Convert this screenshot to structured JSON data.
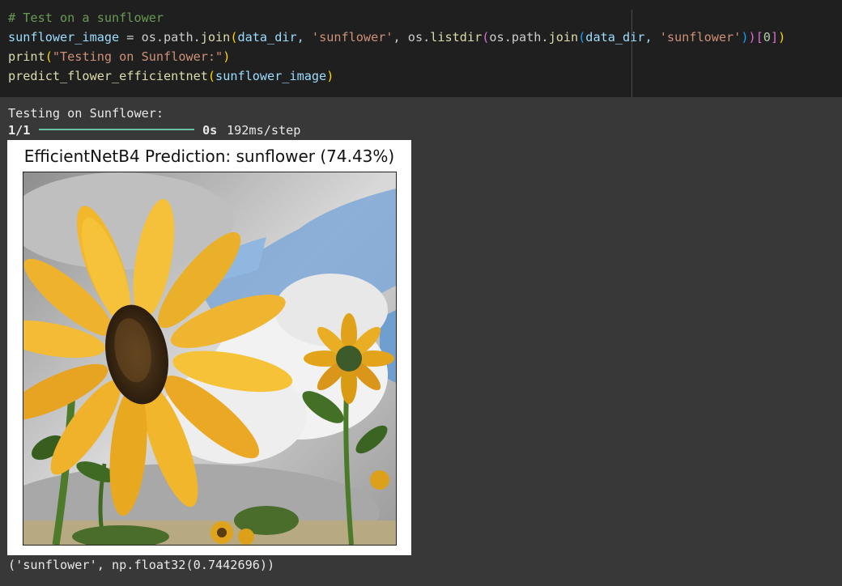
{
  "code": {
    "comment": "# Test on a sunflower",
    "line2": {
      "var": "sunflower_image",
      "op": " = os.path.",
      "fn_join": "join",
      "args_a": "data_dir, ",
      "str_sunflower": "'sunflower'",
      "mid": ", os.",
      "fn_listdir": "listdir",
      "path_join": "os.path.",
      "fn_join2": "join",
      "args_b": "data_dir, ",
      "str_sunflower2": "'sunflower'",
      "index": "0"
    },
    "line3": {
      "fn": "print",
      "str": "\"Testing on Sunflower:\""
    },
    "line4": {
      "fn": "predict_flower_efficientnet",
      "arg": "sunflower_image"
    }
  },
  "output": {
    "line1": "Testing on Sunflower:",
    "progress_step": "1/1",
    "progress_fraction": 1.0,
    "progress_time": "0s",
    "progress_rate": "192ms/step",
    "figure_title": "EfficientNetB4 Prediction: sunflower (74.43%)",
    "result": "('sunflower', np.float32(0.7442696))"
  },
  "colors": {
    "editor_bg": "#1f1f1f",
    "output_bg": "#383838",
    "progress": "#6cc3a1"
  }
}
